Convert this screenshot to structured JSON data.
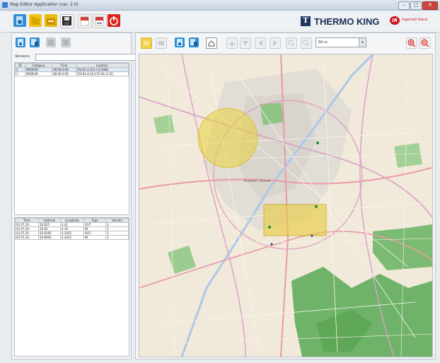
{
  "window": {
    "title": "Map Editor Application (ver. 2.0)",
    "controls": [
      "minimize",
      "maximize",
      "close"
    ]
  },
  "toolbar": {
    "buttons": [
      {
        "name": "open-map-button",
        "icon": "blue-sheet-icon",
        "color": "#2e8fd6"
      },
      {
        "name": "open-folder-button",
        "icon": "folder-icon",
        "color": "#f0c419"
      },
      {
        "name": "import-button",
        "icon": "folder-import-icon",
        "color": "#e9b90f"
      },
      {
        "name": "save-button",
        "icon": "floppy-disk-icon",
        "color": "#2b2b2b"
      },
      {
        "name": "export-button",
        "icon": "red-document-icon",
        "color": "#d43a3a"
      },
      {
        "name": "print-button",
        "icon": "red-document-print-icon",
        "color": "#d43a3a"
      },
      {
        "name": "power-button",
        "icon": "power-icon",
        "color": "#d9251c"
      }
    ]
  },
  "brand": {
    "thermo_king": "THERMO KING",
    "thermo_king_mark": "T",
    "ingersoll_mark": "IR",
    "ingersoll_text": "Ingersoll Rand"
  },
  "left_panel": {
    "versions_label": "Versions",
    "versions_value": "",
    "zones_table": {
      "columns": [
        "ID",
        "Category",
        "Time",
        "Location"
      ],
      "rows": [
        [
          "2",
          "MEDIUM",
          "08:00-0:00",
          "[50.87,4.32]->[2.848]"
        ],
        [
          "1",
          "MEDIUM",
          "08:00-0:00",
          "[50.83,4.42]-[50.81,4.35]"
        ]
      ]
    },
    "points_table": {
      "columns": [
        "Time",
        "Latitude",
        "Longitude",
        "Type",
        "Version"
      ],
      "rows": [
        [
          "03.07.20..",
          "50.825",
          "4.42",
          "OUT",
          "3"
        ],
        [
          "03.07.20..",
          "50.82",
          "4.36",
          "IN",
          "3"
        ],
        [
          "03.07.20..",
          "50.8195",
          "4.3435",
          "OUT",
          "3"
        ],
        [
          "03.07.20..",
          "50.8095",
          "4.4435",
          "IN",
          "3"
        ]
      ]
    }
  },
  "map_toolbar": {
    "zoom_value": "50 m",
    "zoom_in": "zoom-in-icon",
    "zoom_out": "zoom-out-icon"
  },
  "map": {
    "city_label": "Bruxelles - Brussel",
    "zone_colors": {
      "circle": "#e8d23a",
      "rect": "#e8c93a"
    },
    "park_color": "#6fb36a",
    "water_color": "#aac9e8"
  }
}
